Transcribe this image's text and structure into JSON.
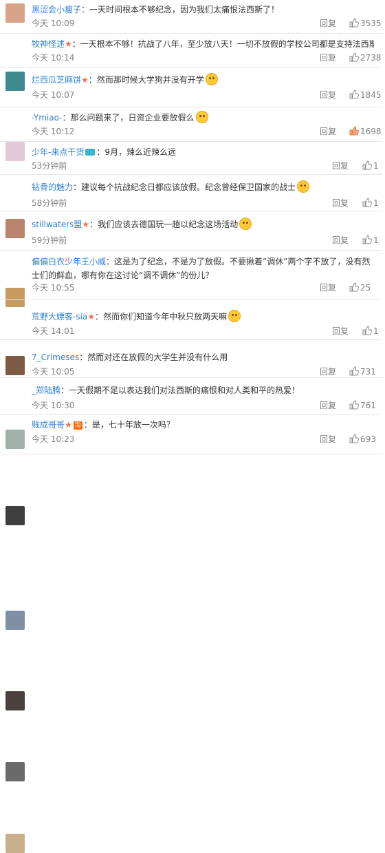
{
  "comments": [
    {
      "user": "黑涩会小瘦子",
      "sep": "：",
      "text": "一天时间根本不够纪念，因为我们太痛恨法西斯了！",
      "time": "今天 10:09",
      "reply": "回复",
      "likes": "3535",
      "badge": "none"
    },
    {
      "user": "牧神怪述",
      "sep": "：",
      "text": "一天根本不够！抗战了八年，至少放八天！一切不放假的学校公司都是支持法西斯的",
      "time": "今天 10:14",
      "reply": "回复",
      "likes": "2738",
      "badge": "star"
    },
    {
      "user": "烂西瓜芝麻饼",
      "sep": "：",
      "text": "然而那时候大学狗并没有开学",
      "time": "今天 10:07",
      "reply": "回复",
      "likes": "1845",
      "badge": "star",
      "emoji": "cat-emoji"
    },
    {
      "user": "-Ymiao-",
      "sep": "：",
      "text": "那么问题来了，日资企业要放假么",
      "time": "今天 10:12",
      "reply": "回复",
      "likes": "1698",
      "badge": "none",
      "emoji": "laugh-emoji"
    },
    {
      "user": "少年-来点干货",
      "sep": "：",
      "text": "9月，辣么近辣么远",
      "time": "53分钟前",
      "reply": "回复",
      "likes": "1",
      "badge": "camera"
    },
    {
      "user": "钻骨的魅力",
      "sep": "：",
      "text": "建议每个抗战纪念日都应该放假。纪念曾经保卫国家的战士",
      "time": "58分钟前",
      "reply": "回复",
      "likes": "1",
      "badge": "none",
      "emoji": "doge-emoji"
    },
    {
      "user": "stillwaters盟",
      "sep": "：",
      "text": "我们应该去德国玩一趟以纪念这场活动",
      "time": "59分钟前",
      "reply": "回复",
      "likes": "1",
      "badge": "star",
      "emoji": "grin-emoji"
    },
    {
      "user": "偏偏白衣少年王小威",
      "sep": "：",
      "text": "这是为了纪念，不是为了放假。不要揪着“调休”两个字不放了，没有烈士们的鲜血，哪有你在这讨论“调不调休”的份儿？",
      "time": "今天 10:55",
      "reply": "回复",
      "likes": "25",
      "badge": "none"
    },
    {
      "user": "荒野大嫖客-sia",
      "sep": "：",
      "text": "然而你们知道今年中秋只放两天嘛",
      "time": "今天 14:01",
      "reply": "回复",
      "likes": "1",
      "badge": "star",
      "emoji": "cat-emoji"
    },
    {
      "user": "7_Crimeses",
      "sep": "：",
      "text": "然而对还在放假的大学生并没有什么用",
      "time": "今天 10:05",
      "reply": "回复",
      "likes": "731",
      "badge": "none"
    },
    {
      "user": "_郑陆腾",
      "sep": "：",
      "text": "一天假期不足以表达我们对法西斯的痛恨和对人类和平的热爱！",
      "time": "今天 10:30",
      "reply": "回复",
      "likes": "761",
      "badge": "none"
    },
    {
      "user": "贱成哥哥",
      "sep": "：",
      "text": "是，七十年放一次吗？",
      "time": "今天 10:23",
      "reply": "回复",
      "likes": "693",
      "badge": "star-tao",
      "tao": "淘"
    }
  ]
}
